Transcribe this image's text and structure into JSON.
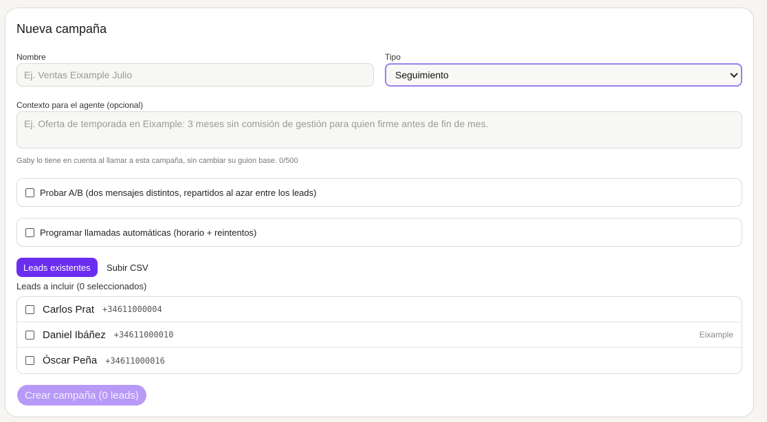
{
  "form": {
    "title": "Nueva campaña",
    "name_label": "Nombre",
    "name_placeholder": "Ej. Ventas Eixample Julio",
    "type_label": "Tipo",
    "type_selected": "Seguimiento",
    "context_label": "Contexto para el agente (opcional)",
    "context_placeholder": "Ej. Oferta de temporada en Eixample: 3 meses sin comisión de gestión para quien firme antes de fin de mes.",
    "context_hint": "Gaby lo tiene en cuenta al llamar a esta campaña, sin cambiar su guion base. 0/500",
    "ab_label": "Probar A/B (dos mensajes distintos, repartidos al azar entre los leads)",
    "schedule_label": "Programar llamadas automáticas (horario + reintentos)"
  },
  "tabs": {
    "existing": "Leads existentes",
    "csv": "Subir CSV"
  },
  "leads": {
    "header": "Leads a incluir (0 seleccionados)",
    "items": [
      {
        "name": "Carlos Prat",
        "phone": "+34611000004",
        "tag": ""
      },
      {
        "name": "Daniel Ibáñez",
        "phone": "+34611000010",
        "tag": "Eixample"
      },
      {
        "name": "Óscar Peña",
        "phone": "+34611000016",
        "tag": ""
      }
    ]
  },
  "create_button": "Crear campaña (0 leads)",
  "colors": {
    "accent": "#6b2df0",
    "accent_disabled": "#b799f7",
    "select_border": "#9b7ef0"
  }
}
